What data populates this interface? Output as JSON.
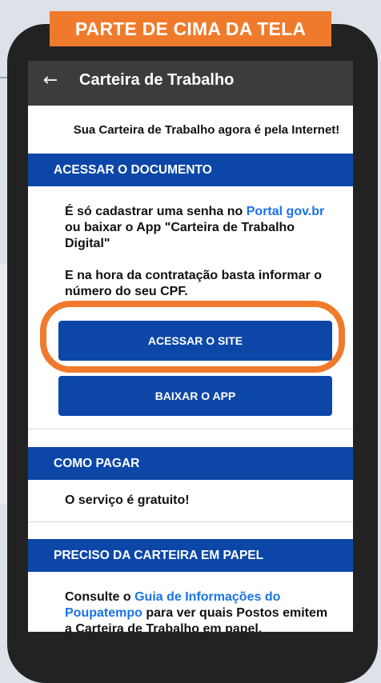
{
  "banner": {
    "text": "PARTE DE CIMA DA TELA"
  },
  "appbar": {
    "back_icon": "arrow-left-icon",
    "back_glyph": "←",
    "title": "Carteira de Trabalho"
  },
  "intro": "Sua Carteira de Trabalho agora é pela Internet!",
  "sections": {
    "acessar": {
      "header": "ACESSAR O DOCUMENTO",
      "p1_before": "É só cadastrar uma senha no ",
      "p1_link": "Portal gov.br",
      "p1_after": " ou baixar o App \"Carteira de Trabalho Digital\"",
      "p2": "E na hora da contratação basta informar o número do seu CPF.",
      "btn_site": "ACESSAR O SITE",
      "btn_app": "BAIXAR O APP"
    },
    "pagar": {
      "header": "COMO PAGAR",
      "text": "O serviço é gratuito!"
    },
    "papel": {
      "header": "PRECISO DA CARTEIRA EM PAPEL",
      "before": "Consulte o ",
      "link": "Guia de Informações do Poupatempo",
      "after": " para ver quais Postos emitem a Carteira de Trabalho em papel."
    }
  },
  "colors": {
    "accent_orange": "#f07a2c",
    "primary_blue": "#0c47a8",
    "link_blue": "#1a73e8",
    "appbar": "#3c3c3c"
  }
}
